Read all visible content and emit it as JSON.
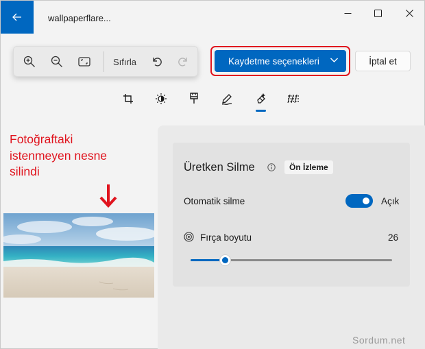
{
  "window": {
    "title": "wallpaperflare..."
  },
  "toolbar": {
    "zoom_in_icon": "zoom-in-icon",
    "zoom_out_icon": "zoom-out-icon",
    "fit_icon": "fit-to-window-icon",
    "reset_label": "Sıfırla",
    "undo_icon": "undo-icon",
    "redo_icon": "redo-icon"
  },
  "actions": {
    "save_label": "Kaydetme seçenekleri",
    "cancel_label": "İptal et"
  },
  "tools": [
    {
      "name": "crop",
      "icon": "crop-icon",
      "active": false
    },
    {
      "name": "adjust",
      "icon": "brightness-icon",
      "active": false
    },
    {
      "name": "filter",
      "icon": "brush-icon",
      "active": false
    },
    {
      "name": "markup",
      "icon": "pen-icon",
      "active": false
    },
    {
      "name": "erase",
      "icon": "eraser-icon",
      "active": true
    },
    {
      "name": "background",
      "icon": "background-icon",
      "active": false
    }
  ],
  "annotation": {
    "lines": [
      "Fotoğraftaki",
      "istenmeyen nesne",
      "silindi"
    ],
    "color": "#e0141e"
  },
  "panel": {
    "title": "Üretken Silme",
    "badge": "Ön İzleme",
    "auto_erase_label": "Otomatik silme",
    "auto_erase_state": "Açık",
    "auto_erase_on": true,
    "brush_label": "Fırça boyutu",
    "brush_value": "26",
    "brush_fraction": 0.17
  },
  "watermark": "Sordum.net",
  "colors": {
    "accent": "#0067c0",
    "highlight": "#e0141e"
  }
}
